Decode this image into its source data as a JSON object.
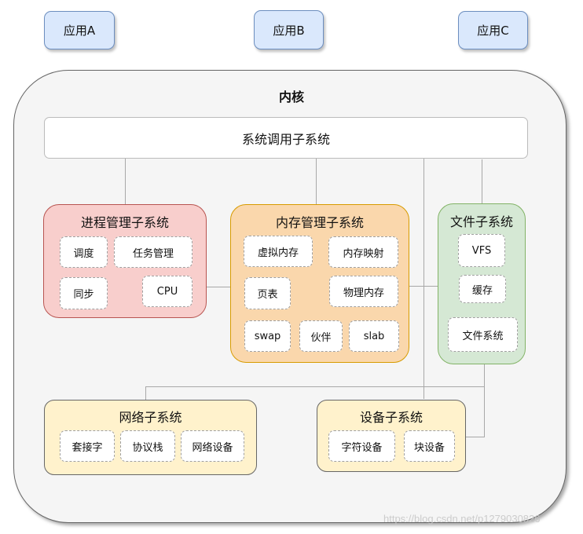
{
  "apps": [
    {
      "label": "应用A"
    },
    {
      "label": "应用B"
    },
    {
      "label": "应用C"
    }
  ],
  "kernel": {
    "title": "内核",
    "syscall": "系统调用子系统",
    "process": {
      "title": "进程管理子系统",
      "items": [
        "调度",
        "任务管理",
        "同步",
        "CPU"
      ]
    },
    "memory": {
      "title": "内存管理子系统",
      "items": [
        "虚拟内存",
        "内存映射",
        "页表",
        "物理内存",
        "swap",
        "伙伴",
        "slab"
      ]
    },
    "file": {
      "title": "文件子系统",
      "items": [
        "VFS",
        "缓存",
        "文件系统"
      ]
    },
    "network": {
      "title": "网络子系统",
      "items": [
        "套接字",
        "协议栈",
        "网络设备"
      ]
    },
    "device": {
      "title": "设备子系统",
      "items": [
        "字符设备",
        "块设备"
      ]
    }
  },
  "colors": {
    "app_fill": "#dae8fc",
    "process_fill": "#f8cecc",
    "memory_fill": "#fad7ac",
    "file_fill": "#d5e8d4",
    "network_fill": "#fff2cc",
    "device_fill": "#fff2cc",
    "kernel_fill": "#f5f5f5"
  },
  "watermark": "https://blog.csdn.net/p1279030826"
}
